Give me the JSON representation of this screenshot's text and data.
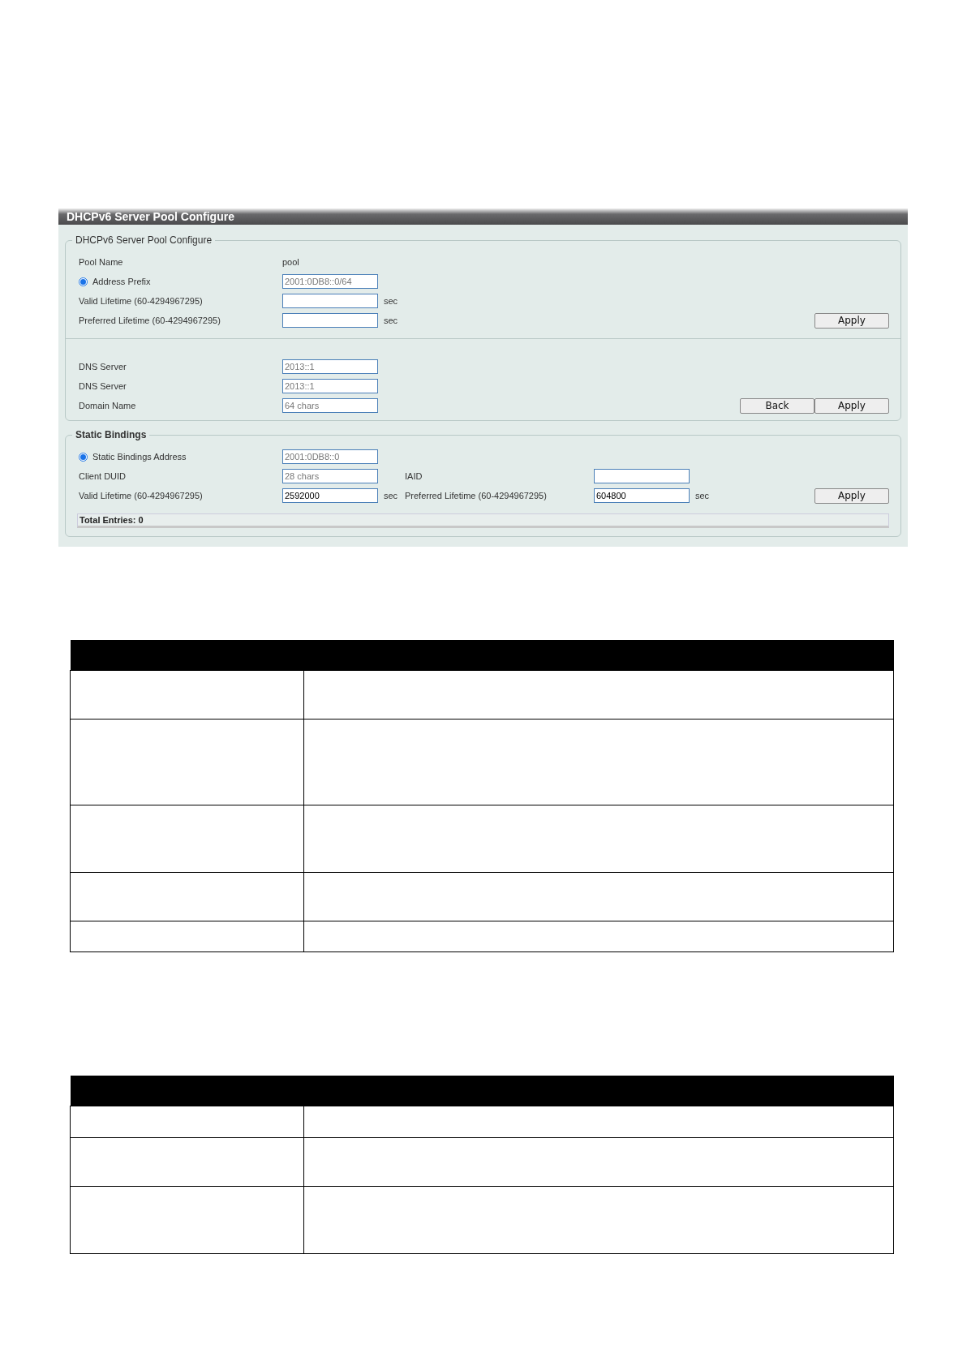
{
  "panel": {
    "title": "DHCPv6 Server Pool Configure",
    "pool_section": {
      "legend": "DHCPv6 Server Pool Configure",
      "pool_name": {
        "label": "Pool Name",
        "value": "pool"
      },
      "address_prefix": {
        "label": "Address Prefix",
        "selected": true,
        "placeholder": "2001:0DB8::0/64"
      },
      "valid_lifetime": {
        "label": "Valid Lifetime (60-4294967295)",
        "unit": "sec"
      },
      "preferred_lifetime": {
        "label": "Preferred Lifetime (60-4294967295)",
        "unit": "sec"
      },
      "apply_button": "Apply",
      "dns_servers": [
        {
          "label": "DNS Server",
          "placeholder": "2013::1"
        },
        {
          "label": "DNS Server",
          "placeholder": "2013::1"
        }
      ],
      "domain_name": {
        "label": "Domain Name",
        "placeholder": "64 chars"
      },
      "buttons": [
        "Back",
        "Apply"
      ]
    },
    "static_bindings": {
      "legend": "Static Bindings",
      "address": {
        "label": "Static Bindings Address",
        "selected": true,
        "placeholder": "2001:0DB8::0"
      },
      "client_duid": {
        "label": "Client DUID",
        "placeholder": "28 chars"
      },
      "iaid": {
        "label": "IAID"
      },
      "valid_lifetime": {
        "label": "Valid Lifetime (60-4294967295)",
        "value": "2592000",
        "unit": "sec"
      },
      "preferred_lifetime": {
        "label": "Preferred Lifetime (60-4294967295)",
        "value": "604800",
        "unit": "sec"
      },
      "apply_button": "Apply",
      "total_entries": "Total Entries: 0"
    }
  }
}
